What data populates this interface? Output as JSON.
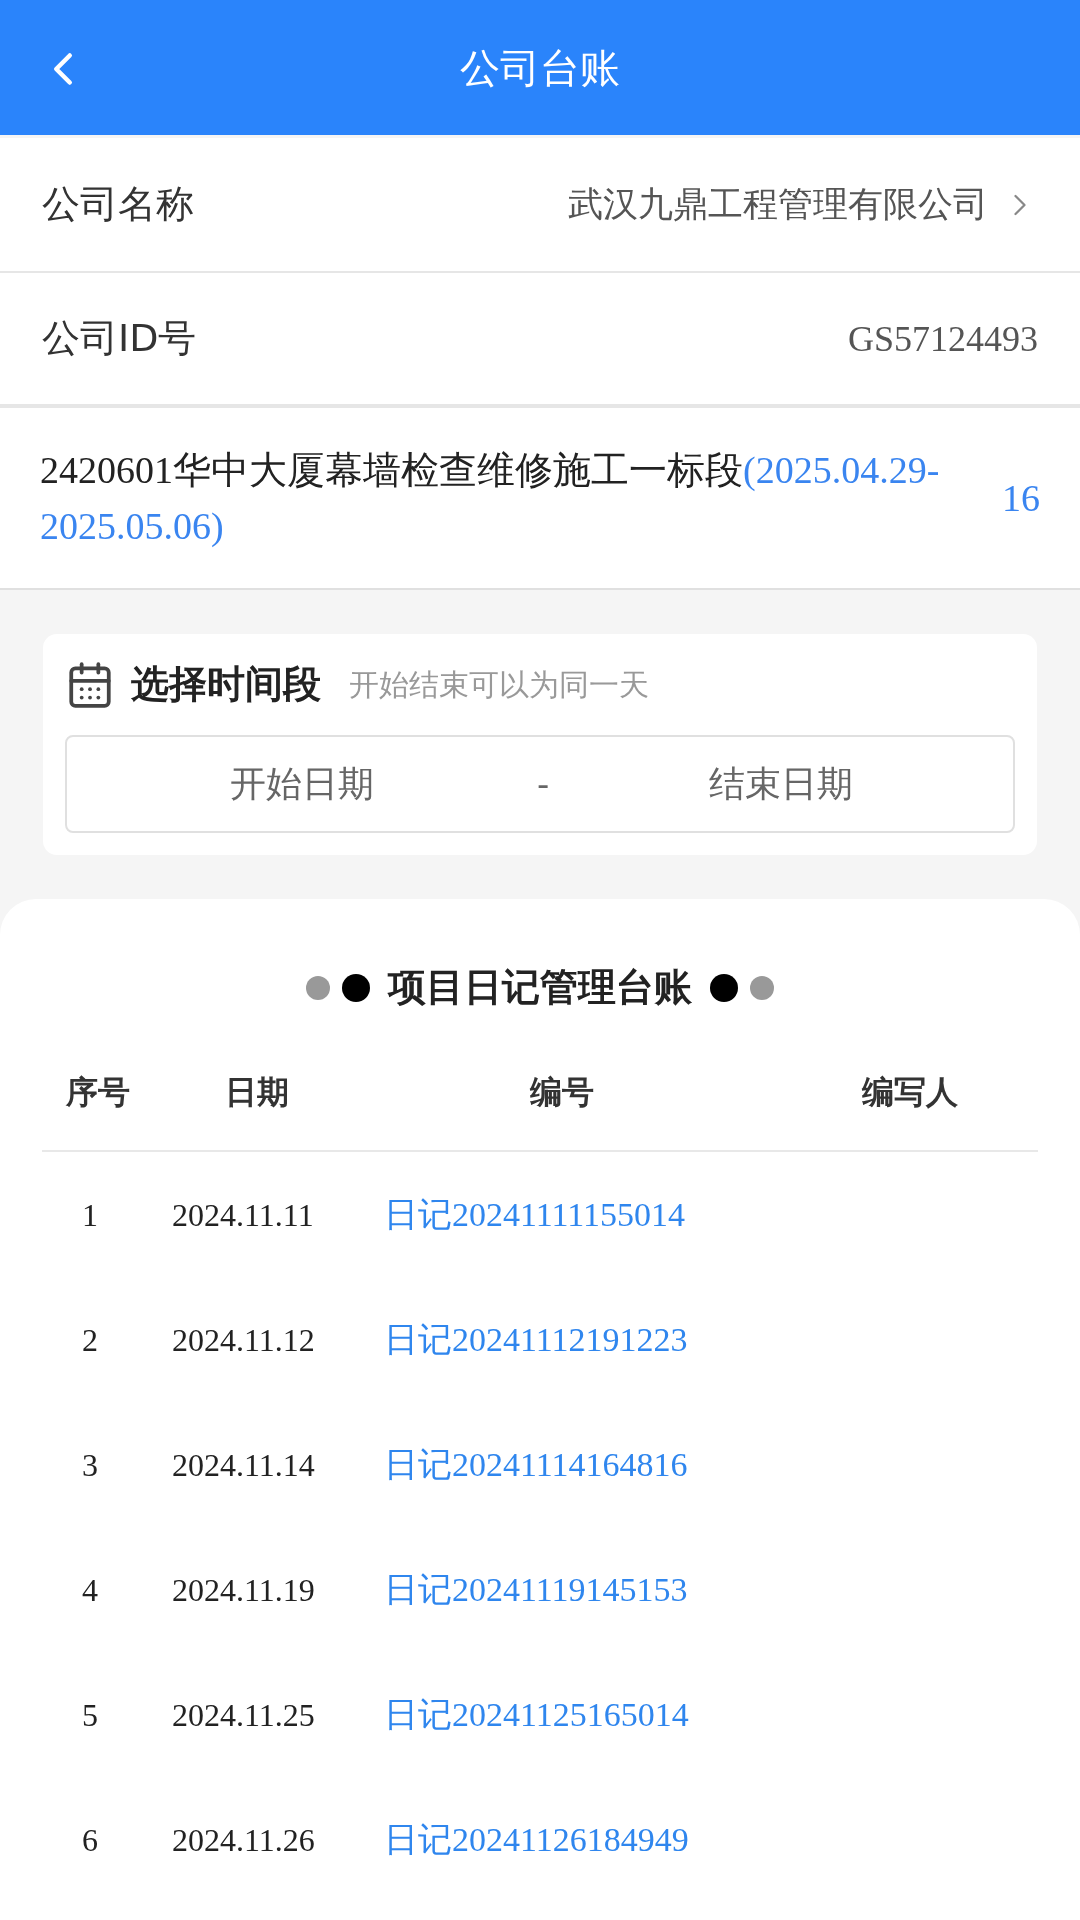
{
  "header": {
    "title": "公司台账"
  },
  "company_name": {
    "label": "公司名称",
    "value": "武汉九鼎工程管理有限公司"
  },
  "company_id": {
    "label": "公司ID号",
    "value": "GS57124493"
  },
  "project": {
    "name": "2420601华中大厦幕墙检查维修施工一标段",
    "date_range": "(2025.04.29-2025.05.06)",
    "count": "16"
  },
  "period": {
    "title": "选择时间段",
    "hint": "开始结束可以为同一天",
    "start_placeholder": "开始日期",
    "separator": "-",
    "end_placeholder": "结束日期"
  },
  "ledger": {
    "title": "项目日记管理台账",
    "columns": [
      "序号",
      "日期",
      "编号",
      "编写人"
    ],
    "rows": [
      {
        "index": "1",
        "date": "2024.11.11",
        "code": "日记20241111155014"
      },
      {
        "index": "2",
        "date": "2024.11.12",
        "code": "日记20241112191223"
      },
      {
        "index": "3",
        "date": "2024.11.14",
        "code": "日记20241114164816"
      },
      {
        "index": "4",
        "date": "2024.11.19",
        "code": "日记20241119145153"
      },
      {
        "index": "5",
        "date": "2024.11.25",
        "code": "日记20241125165014"
      },
      {
        "index": "6",
        "date": "2024.11.26",
        "code": "日记20241126184949"
      }
    ]
  }
}
